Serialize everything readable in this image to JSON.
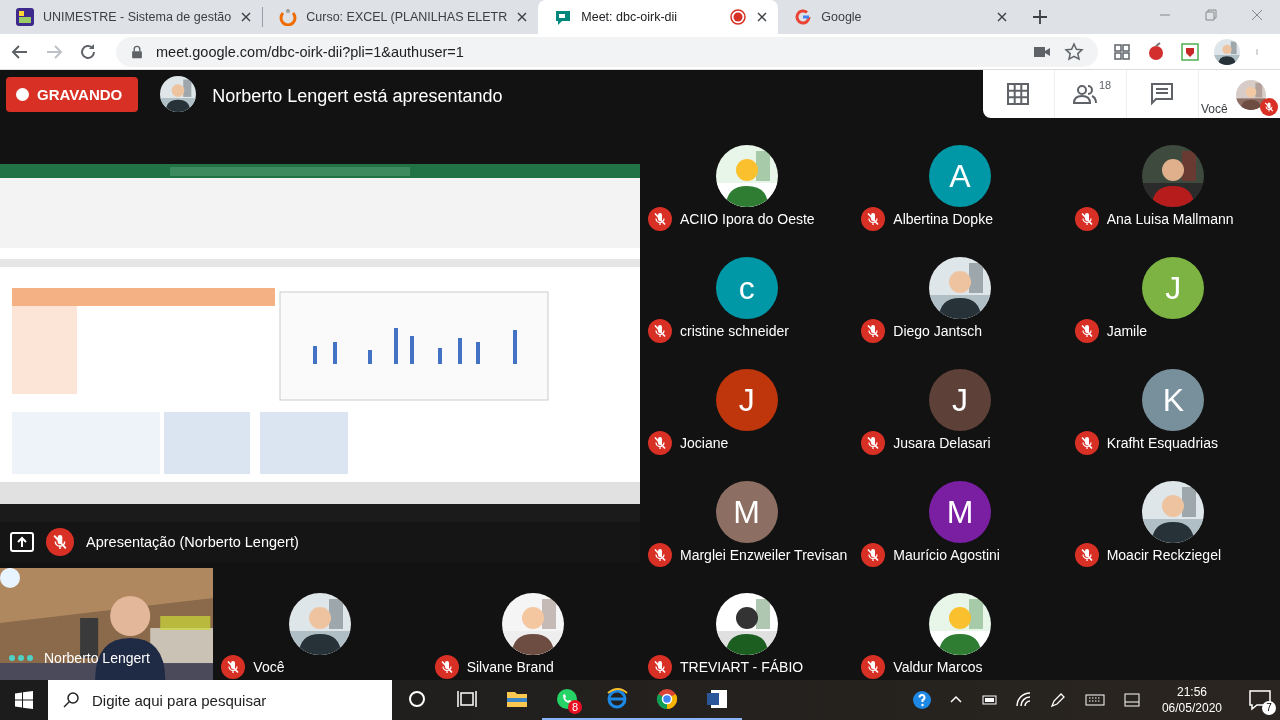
{
  "browser": {
    "tabs": [
      {
        "title": "UNIMESTRE - Sistema de gestão",
        "selected": false,
        "recording": false
      },
      {
        "title": "Curso: EXCEL (PLANILHAS ELETR",
        "selected": false,
        "recording": false
      },
      {
        "title": "Meet: dbc-oirk-dii",
        "selected": true,
        "recording": true
      },
      {
        "title": "Google",
        "selected": false,
        "recording": false
      }
    ],
    "url": "meet.google.com/dbc-oirk-dii?pli=1&authuser=1"
  },
  "meet": {
    "recording_label": "GRAVANDO",
    "presenter_banner": "Norberto Lengert está apresentando",
    "participant_count": "18",
    "self": {
      "label": "Você",
      "muted": true
    },
    "presentation": {
      "label": "Apresentação (Norberto Lengert)",
      "muted": true
    },
    "grid": [
      {
        "name": "ACIIO Ipora do Oeste",
        "muted": true
      },
      {
        "name": "Albertina Dopke",
        "muted": true,
        "avatar": {
          "kind": "letter",
          "letter": "A",
          "color": "#0097a7"
        }
      },
      {
        "name": "Ana Luisa Mallmann",
        "muted": true
      },
      {
        "name": "cristine schneider",
        "muted": true,
        "avatar": {
          "kind": "letter",
          "letter": "c",
          "color": "#0097a7"
        }
      },
      {
        "name": "Diego Jantsch",
        "muted": true
      },
      {
        "name": "Jamile",
        "muted": true,
        "avatar": {
          "kind": "letter",
          "letter": "J",
          "color": "#7cb342"
        }
      },
      {
        "name": "Jociane",
        "muted": true,
        "avatar": {
          "kind": "letter",
          "letter": "J",
          "color": "#bf360c"
        }
      },
      {
        "name": "Jusara Delasari",
        "muted": true,
        "avatar": {
          "kind": "letter",
          "letter": "J",
          "color": "#5d4037"
        }
      },
      {
        "name": "Krafht Esquadrias",
        "muted": true,
        "avatar": {
          "kind": "letter",
          "letter": "K",
          "color": "#78909c"
        }
      },
      {
        "name": "Marglei Enzweiler Trevisan",
        "muted": true,
        "avatar": {
          "kind": "letter",
          "letter": "M",
          "color": "#8d6e63"
        }
      },
      {
        "name": "Maurício Agostini",
        "muted": true,
        "avatar": {
          "kind": "letter",
          "letter": "M",
          "color": "#7b1fa2"
        }
      },
      {
        "name": "Moacir Reckziegel",
        "muted": true
      }
    ],
    "bottom_row": [
      {
        "name": "Norberto Lengert",
        "muted": false,
        "speaking": true,
        "avatar": {
          "kind": "video"
        }
      },
      {
        "name": "Você",
        "muted": true
      },
      {
        "name": "Silvane Brand",
        "muted": true
      },
      {
        "name": "TREVIART - FÁBIO",
        "muted": true
      },
      {
        "name": "Valdur Marcos",
        "muted": true
      }
    ]
  },
  "taskbar": {
    "search_placeholder": "Digite aqui para pesquisar",
    "apps": [
      {
        "running": false
      },
      {
        "running": true,
        "badge": "8"
      },
      {
        "running": true
      },
      {
        "running": true
      },
      {
        "running": true
      }
    ],
    "time": "21:56",
    "date": "06/05/2020",
    "notifications": "7"
  }
}
